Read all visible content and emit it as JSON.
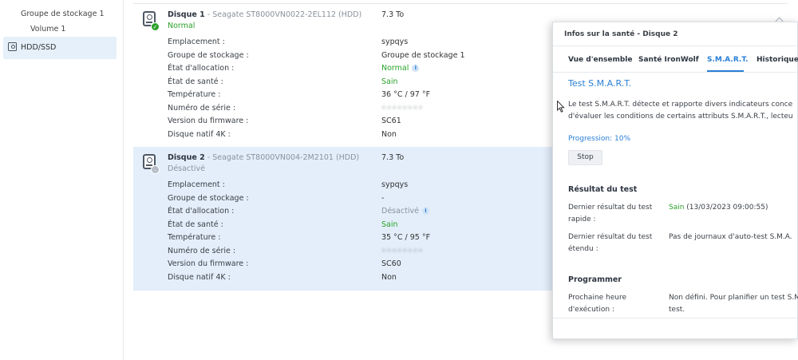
{
  "sidebar": {
    "items": [
      {
        "label": "Groupe de stockage 1"
      },
      {
        "label": "Volume 1"
      },
      {
        "label": "HDD/SSD",
        "active": true
      }
    ]
  },
  "disks": [
    {
      "name": "Disque 1",
      "model": " - Seagate ST8000VN0022-2EL112 (HDD)",
      "status": "Normal",
      "size": "7.3 To",
      "status_icon": "check-icon",
      "rows": [
        {
          "key": "Emplacement :",
          "value": "sypqys"
        },
        {
          "key": "Groupe de stockage :",
          "value": "Groupe de stockage 1"
        },
        {
          "key": "État d'allocation :",
          "value": "Normal"
        },
        {
          "key": "État de santé :",
          "value": "Sain"
        },
        {
          "key": "Température :",
          "value": "36 °C / 97 °F"
        },
        {
          "key": "Numéro de série :",
          "value": "••••••••"
        },
        {
          "key": "Version du firmware :",
          "value": "SC61"
        },
        {
          "key": "Disque natif 4K :",
          "value": "Non"
        }
      ]
    },
    {
      "name": "Disque 2",
      "model": " - Seagate ST8000VN004-2M2101 (HDD)",
      "status": "Désactivé",
      "size": "7.3 To",
      "status_icon": "disabled-icon",
      "rows": [
        {
          "key": "Emplacement :",
          "value": "sypqys"
        },
        {
          "key": "Groupe de stockage :",
          "value": "-"
        },
        {
          "key": "État d'allocation :",
          "value": "Désactivé"
        },
        {
          "key": "État de santé :",
          "value": "Sain"
        },
        {
          "key": "Température :",
          "value": "35 °C / 95 °F"
        },
        {
          "key": "Numéro de série :",
          "value": "••••••••"
        },
        {
          "key": "Version du firmware :",
          "value": "SC60"
        },
        {
          "key": "Disque natif 4K :",
          "value": "Non"
        }
      ]
    }
  ],
  "panel": {
    "title": "Infos sur la santé - Disque 2",
    "tabs": [
      {
        "label": "Vue d'ensemble"
      },
      {
        "label": "Santé IronWolf"
      },
      {
        "label": "S.M.A.R.T.",
        "active": true
      },
      {
        "label": "Historique"
      }
    ],
    "smart_link": "Test S.M.A.R.T.",
    "description_line1": "Le test S.M.A.R.T. détecte et rapporte divers indicateurs conce",
    "description_line2": "d'évaluer les conditions de certains attributs S.M.A.R.T., lecteu",
    "progress": "Progression: 10%",
    "stop_label": "Stop",
    "result_heading": "Résultat du test",
    "quick_label": "Dernier résultat du test rapide :",
    "quick_status": "Sain",
    "quick_date": " (13/03/2023 09:00:55)",
    "extended_label": "Dernier résultat du test étendu :",
    "extended_value": "Pas de journaux d'auto-test S.M.A.",
    "schedule_heading": "Programmer",
    "next_label": "Prochaine heure d'exécution :",
    "next_value_line1": "Non défini. Pour planifier un test S.M",
    "next_value_line2": "test."
  },
  "colors": {
    "accent": "#2a7fd4",
    "ok": "#2aa22a",
    "selected_row": "#e3eefa"
  }
}
